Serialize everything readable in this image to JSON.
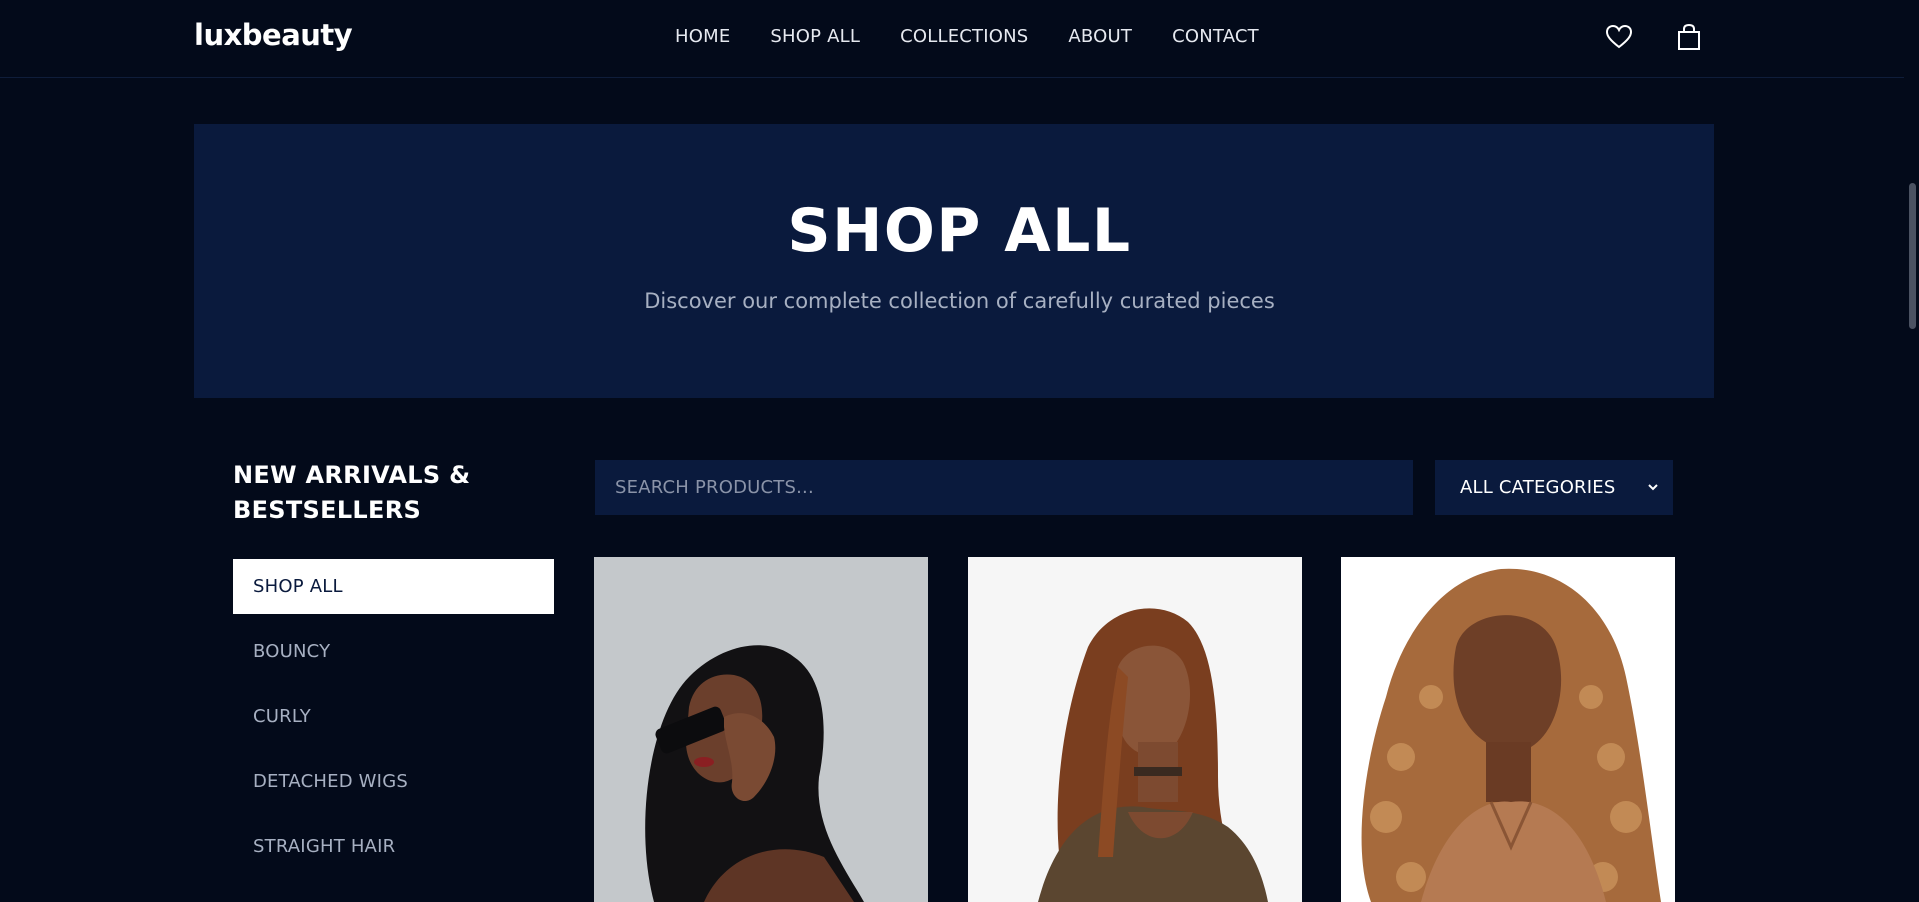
{
  "header": {
    "logo": "luxbeauty",
    "nav": [
      "HOME",
      "SHOP ALL",
      "COLLECTIONS",
      "ABOUT",
      "CONTACT"
    ],
    "icons": [
      "heart-icon",
      "shopping-bag-icon"
    ]
  },
  "banner": {
    "title": "SHOP ALL",
    "subtitle": "Discover our complete collection of carefully curated pieces"
  },
  "sidebar": {
    "title": "NEW ARRIVALS & BESTSELLERS",
    "categories": [
      "SHOP ALL",
      "BOUNCY",
      "CURLY",
      "DETACHED WIGS",
      "STRAIGHT HAIR"
    ],
    "active_index": 0
  },
  "search": {
    "placeholder": "SEARCH PRODUCTS..."
  },
  "filter": {
    "selected": "ALL CATEGORIES"
  },
  "products": [
    {
      "image": "woman-with-sunglasses-dark-wavy-hair"
    },
    {
      "image": "woman-with-straight-auburn-hair"
    },
    {
      "image": "woman-with-curly-honey-blonde-hair"
    }
  ],
  "colors": {
    "background": "#030a1a",
    "panel": "#0a1a3d",
    "text": "#ffffff",
    "muted_text": "#a7b0c2"
  }
}
